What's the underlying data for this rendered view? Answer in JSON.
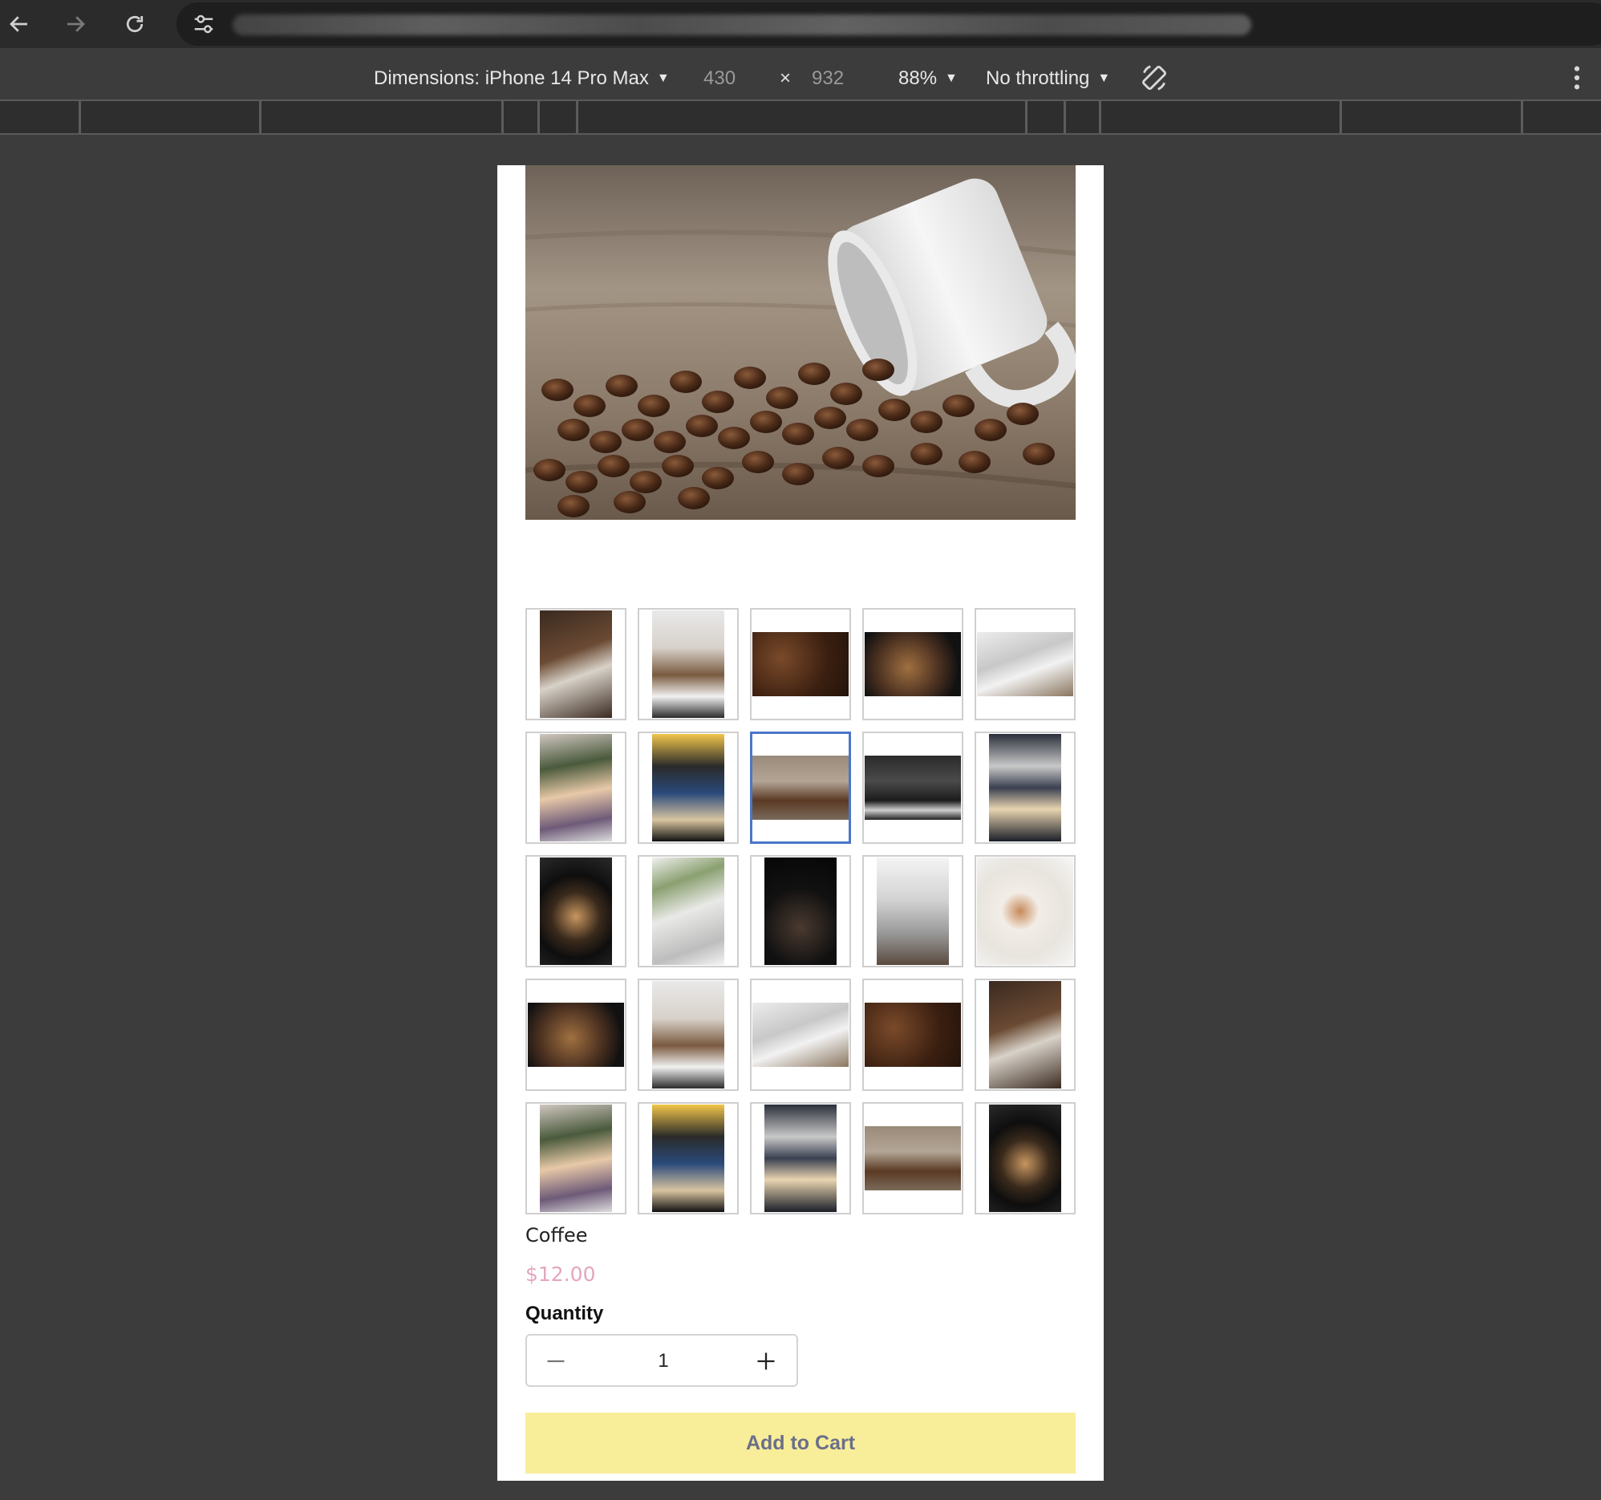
{
  "browser": {
    "back": "back-arrow",
    "forward": "forward-arrow",
    "reload": "reload",
    "site_info": "tune-icon"
  },
  "devtools": {
    "device_label": "Dimensions: iPhone 14 Pro Max",
    "width": "430",
    "times": "×",
    "height": "932",
    "zoom": "88%",
    "throttle": "No throttling",
    "rotate_icon": "rotate-icon",
    "more_icon": "vertical-ellipsis"
  },
  "product": {
    "title": "Coffee",
    "price": "$12.00",
    "quantity_label": "Quantity",
    "quantity_value": "1",
    "add_to_cart": "Add to Cart"
  },
  "gallery": {
    "selected_index": 7,
    "thumbnails": [
      "coffee-scale",
      "iced-coffee-pour",
      "coffee-beans",
      "roaster-beans",
      "laptop-coffee",
      "lavender-latte",
      "pour-over-blue-cup",
      "spilled-cup-beans",
      "espresso-machine",
      "latte-art-pour",
      "black-cup-latte",
      "plant-desk-coffee",
      "dark-espresso-drip",
      "foggy-city-coffee",
      "heart-latte",
      "roaster-beans",
      "iced-coffee-pour",
      "laptop-coffee",
      "coffee-beans",
      "coffee-scale",
      "lavender-latte",
      "pour-over-blue-cup",
      "latte-art-pour",
      "spilled-cup-beans",
      "black-cup-latte"
    ]
  }
}
